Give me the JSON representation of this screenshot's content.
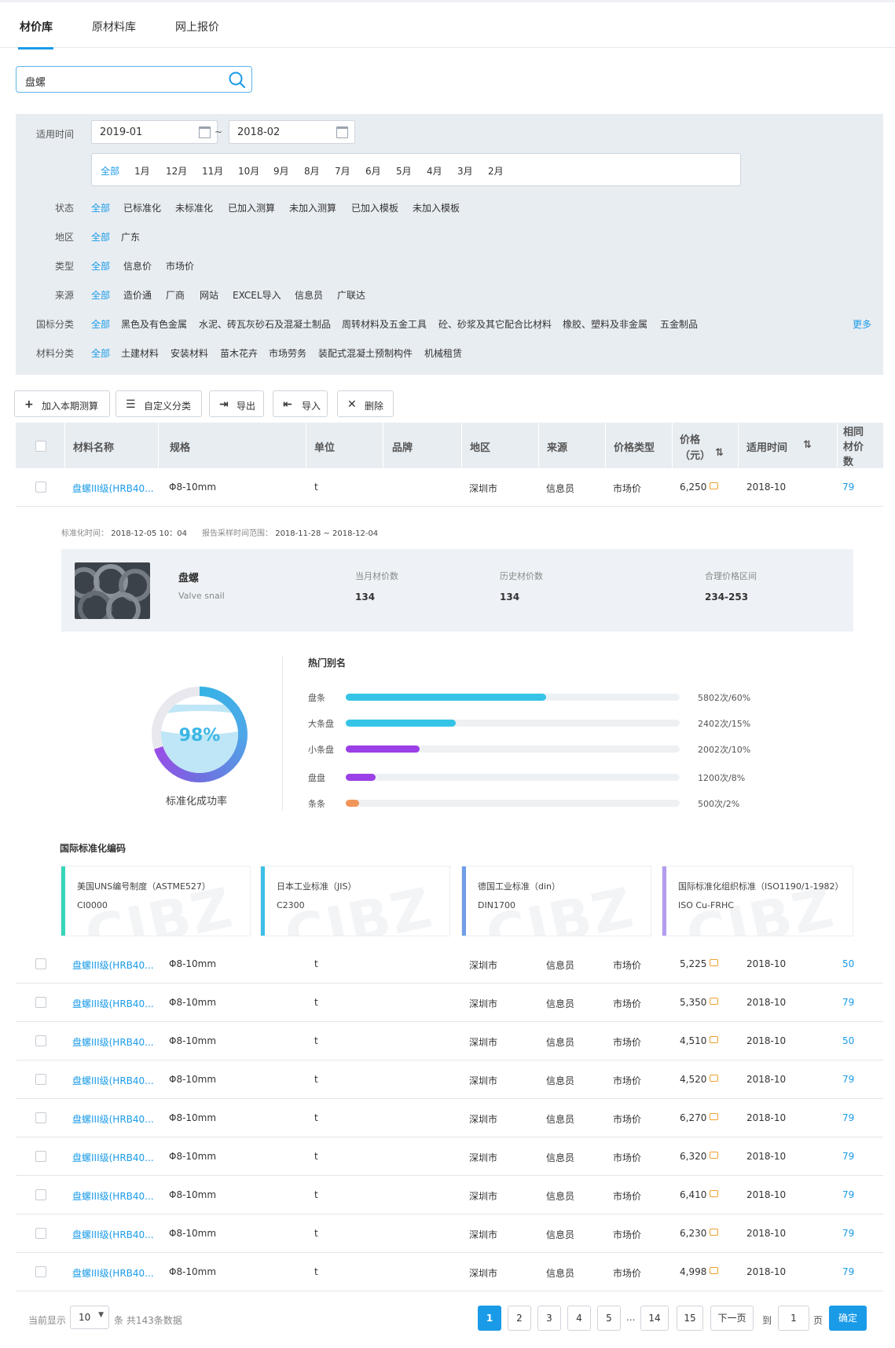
{
  "tabs": [
    "材价库",
    "原材料库",
    "网上报价"
  ],
  "search": {
    "value": "盘螺"
  },
  "filters": {
    "time_label": "适用时间",
    "date_from": "2019-01",
    "date_to": "2018-02",
    "tilde": "~",
    "months": [
      "全部",
      "1月",
      "12月",
      "11月",
      "10月",
      "9月",
      "8月",
      "7月",
      "6月",
      "5月",
      "4月",
      "3月",
      "2月"
    ],
    "groups": [
      {
        "label": "状态",
        "options": [
          "全部",
          "已标准化",
          "未标准化",
          "已加入测算",
          "未加入测算",
          "已加入模板",
          "未加入模板"
        ]
      },
      {
        "label": "地区",
        "options": [
          "全部",
          "广东"
        ]
      },
      {
        "label": "类型",
        "options": [
          "全部",
          "信息价",
          "市场价"
        ]
      },
      {
        "label": "来源",
        "options": [
          "全部",
          "造价通",
          "厂商",
          "网站",
          "EXCEL导入",
          "信息员",
          "广联达"
        ]
      },
      {
        "label": "国标分类",
        "options": [
          "全部",
          "黑色及有色金属",
          "水泥、砖瓦灰砂石及混凝土制品",
          "周转材料及五金工具",
          "砼、砂浆及其它配合比材料",
          "橡胶、塑料及非金属",
          "五金制品"
        ]
      },
      {
        "label": "材料分类",
        "options": [
          "全部",
          "土建材料",
          "安装材料",
          "苗木花卉",
          "市场劳务",
          "装配式混凝土预制构件",
          "机械租赁"
        ]
      }
    ],
    "more": "更多"
  },
  "toolbar": [
    {
      "icon": "+",
      "label": "加入本期测算"
    },
    {
      "icon": "☰",
      "label": "自定义分类"
    },
    {
      "icon": "⇥",
      "label": "导出"
    },
    {
      "icon": "⇤",
      "label": "导入"
    },
    {
      "icon": "✕",
      "label": "删除"
    }
  ],
  "table": {
    "headers": [
      "材料名称",
      "规格",
      "单位",
      "品牌",
      "地区",
      "来源",
      "价格类型",
      "价格",
      "（元）",
      "适用时间",
      "相同",
      "材价",
      "数"
    ],
    "sort_icon": "⇅",
    "rows": [
      {
        "name": "盘螺III级(HRB40...",
        "spec": "Φ8-10mm",
        "unit": "t",
        "region": "深圳市",
        "source": "信息员",
        "ptype": "市场价",
        "price": "6,250",
        "time": "2018-10",
        "count": "79"
      },
      {
        "name": "盘螺III级(HRB40...",
        "spec": "Φ8-10mm",
        "unit": "t",
        "region": "深圳市",
        "source": "信息员",
        "ptype": "市场价",
        "price": "5,225",
        "time": "2018-10",
        "count": "50"
      },
      {
        "name": "盘螺III级(HRB40...",
        "spec": "Φ8-10mm",
        "unit": "t",
        "region": "深圳市",
        "source": "信息员",
        "ptype": "市场价",
        "price": "5,350",
        "time": "2018-10",
        "count": "79"
      },
      {
        "name": "盘螺III级(HRB40...",
        "spec": "Φ8-10mm",
        "unit": "t",
        "region": "深圳市",
        "source": "信息员",
        "ptype": "市场价",
        "price": "4,510",
        "time": "2018-10",
        "count": "50"
      },
      {
        "name": "盘螺III级(HRB40...",
        "spec": "Φ8-10mm",
        "unit": "t",
        "region": "深圳市",
        "source": "信息员",
        "ptype": "市场价",
        "price": "4,520",
        "time": "2018-10",
        "count": "79"
      },
      {
        "name": "盘螺III级(HRB40...",
        "spec": "Φ8-10mm",
        "unit": "t",
        "region": "深圳市",
        "source": "信息员",
        "ptype": "市场价",
        "price": "6,270",
        "time": "2018-10",
        "count": "79"
      },
      {
        "name": "盘螺III级(HRB40...",
        "spec": "Φ8-10mm",
        "unit": "t",
        "region": "深圳市",
        "source": "信息员",
        "ptype": "市场价",
        "price": "6,320",
        "time": "2018-10",
        "count": "79"
      },
      {
        "name": "盘螺III级(HRB40...",
        "spec": "Φ8-10mm",
        "unit": "t",
        "region": "深圳市",
        "source": "信息员",
        "ptype": "市场价",
        "price": "6,410",
        "time": "2018-10",
        "count": "79"
      },
      {
        "name": "盘螺III级(HRB40...",
        "spec": "Φ8-10mm",
        "unit": "t",
        "region": "深圳市",
        "source": "信息员",
        "ptype": "市场价",
        "price": "6,230",
        "time": "2018-10",
        "count": "79"
      },
      {
        "name": "盘螺III级(HRB40...",
        "spec": "Φ8-10mm",
        "unit": "t",
        "region": "深圳市",
        "source": "信息员",
        "ptype": "市场价",
        "price": "4,998",
        "time": "2018-10",
        "count": "79"
      }
    ]
  },
  "detail": {
    "meta_label1": "标准化时间：",
    "meta_val1": "2018-12-05 10：04",
    "meta_label2": "报告采样时间范围：",
    "meta_val2": "2018-11-28 ~ 2018-12-04",
    "name": "盘螺",
    "name_en": "Valve snail",
    "stats": [
      {
        "label": "当月材价数",
        "value": "134"
      },
      {
        "label": "历史材价数",
        "value": "134"
      },
      {
        "label": "合理价格区间",
        "value": "234-253"
      }
    ],
    "gauge_value": "98%",
    "gauge_fraction": 0.7,
    "gauge_label": "标准化成功率",
    "aliases_title": "热门别名",
    "aliases": [
      {
        "name": "盘条",
        "text": "5802次/60%",
        "fraction": 0.6,
        "color": "#35c4e6"
      },
      {
        "name": "大条盘",
        "text": "2402次/15%",
        "fraction": 0.33,
        "color": "#35c4e6"
      },
      {
        "name": "小条盘",
        "text": "2002次/10%",
        "fraction": 0.22,
        "color": "#9b3fe6"
      },
      {
        "name": "盘盘",
        "text": "1200次/8%",
        "fraction": 0.09,
        "color": "#9b3fe6"
      },
      {
        "name": "条条",
        "text": "500次/2%",
        "fraction": 0.04,
        "color": "#f2955a"
      }
    ],
    "codes_title": "国际标准化编码",
    "codes": [
      {
        "title": "美国UNS编号制度（ASTME527）",
        "code": "CI0000",
        "color": "#36d6b8"
      },
      {
        "title": "日本工业标准（JIS）",
        "code": "C2300",
        "color": "#3cc0e8"
      },
      {
        "title": "德国工业标准（din）",
        "code": "DIN1700",
        "color": "#6f9ee6"
      },
      {
        "title": "国际标准化组织标准（ISO1190/1-1982）",
        "code": "ISO Cu-FRHC",
        "color": "#b39cf0"
      }
    ]
  },
  "pagination": {
    "showing_label": "当前显示",
    "page_size": "10",
    "total_text": "条 共143条数据",
    "pages": [
      "1",
      "2",
      "3",
      "4",
      "5",
      "...",
      "14",
      "15"
    ],
    "next_label": "下一页",
    "goto_label": "到",
    "goto_value": "1",
    "page_unit": "页",
    "confirm_label": "确定"
  }
}
